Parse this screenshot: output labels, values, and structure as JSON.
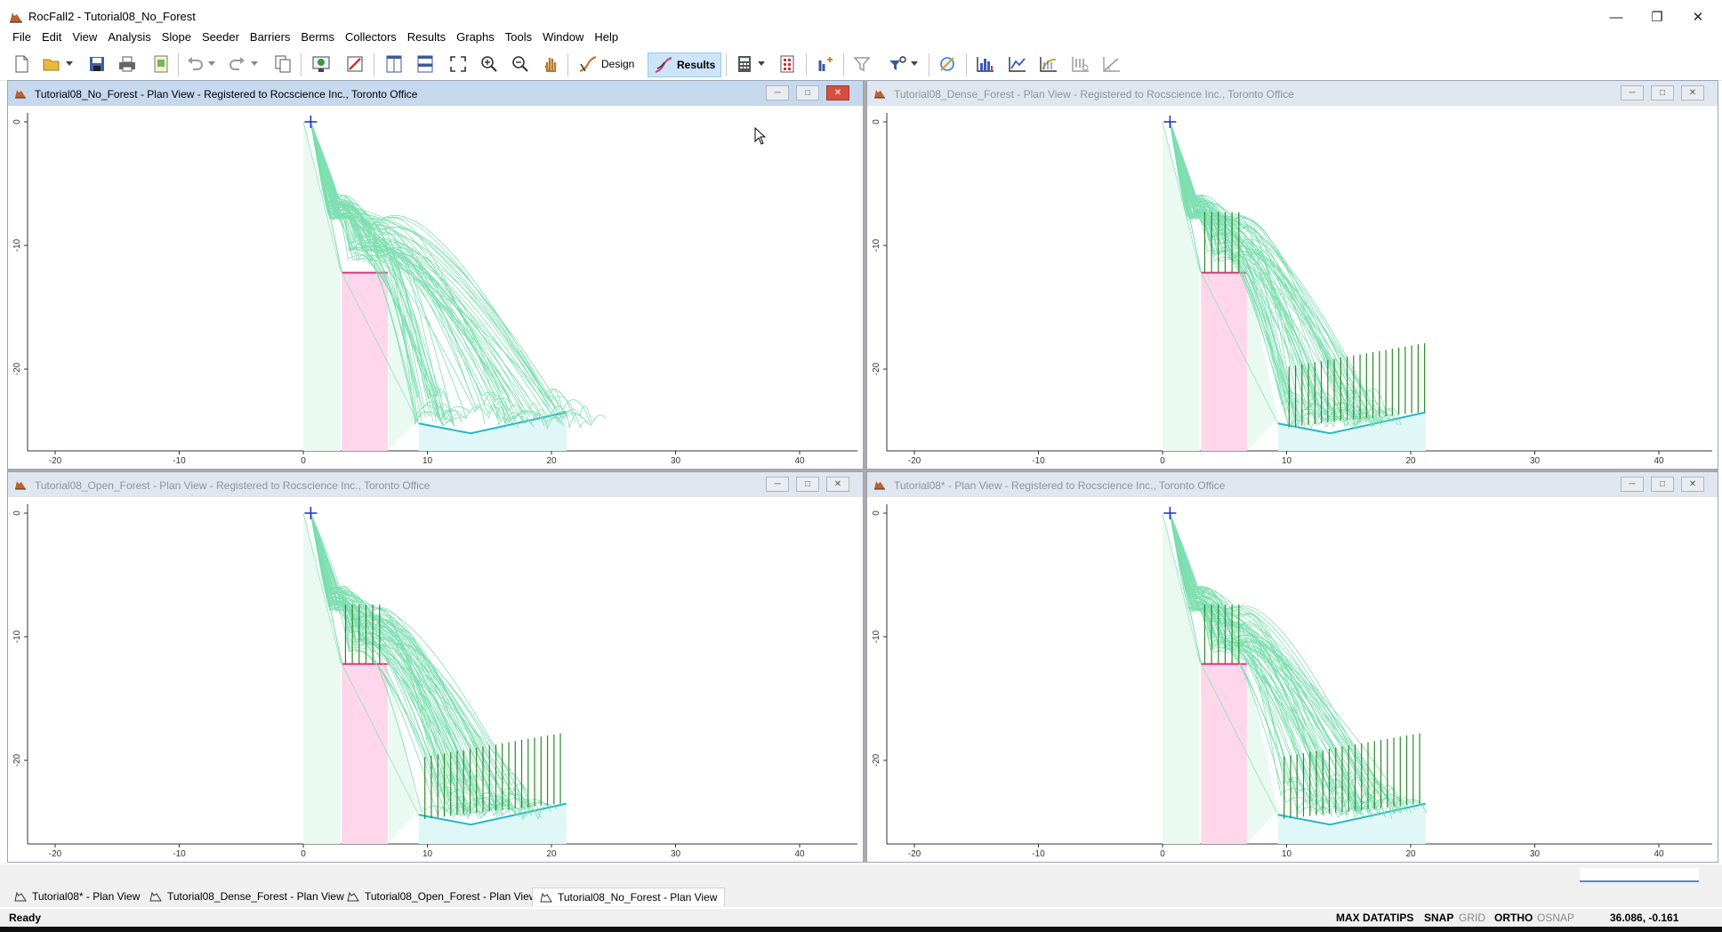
{
  "app": {
    "title": "RocFall2 - Tutorial08_No_Forest",
    "window_buttons": [
      "minimize",
      "restore",
      "close"
    ]
  },
  "menu": [
    "File",
    "Edit",
    "View",
    "Analysis",
    "Slope",
    "Seeder",
    "Barriers",
    "Berms",
    "Collectors",
    "Results",
    "Graphs",
    "Tools",
    "Window",
    "Help"
  ],
  "toolbar": {
    "design_label": "Design",
    "results_label": "Results"
  },
  "panes": [
    {
      "title": "Tutorial08_No_Forest - Plan View - Registered to Rocscience Inc., Toronto Office",
      "active": true,
      "trees": "none"
    },
    {
      "title": "Tutorial08_Dense_Forest - Plan View - Registered to Rocscience Inc., Toronto Office",
      "active": false,
      "trees": "dense"
    },
    {
      "title": "Tutorial08_Open_Forest - Plan View - Registered to Rocscience Inc., Toronto Office",
      "active": false,
      "trees": "open"
    },
    {
      "title": "Tutorial08* - Plan View - Registered to Rocscience Inc., Toronto Office",
      "active": false,
      "trees": "open"
    }
  ],
  "axes": {
    "x_ticks": [
      "-20",
      "-10",
      "0",
      "10",
      "20",
      "30",
      "40"
    ],
    "y_ticks": [
      "0",
      "-10",
      "-20"
    ]
  },
  "colors": {
    "trajectory": "#72dcaa",
    "barrier": "#ffd6ea",
    "barrier_top": "#e0307a",
    "slope_fill": "#eafaf1",
    "ground_line": "#26b7c8",
    "trees": "#2a8a2a",
    "seeder": "#1a2acc"
  },
  "tabs": [
    {
      "label": "Tutorial08* - Plan View",
      "active": false
    },
    {
      "label": "Tutorial08_Dense_Forest - Plan View",
      "active": false
    },
    {
      "label": "Tutorial08_Open_Forest - Plan View",
      "active": false
    },
    {
      "label": "Tutorial08_No_Forest - Plan View",
      "active": true
    }
  ],
  "status": {
    "ready": "Ready",
    "max_datatips": "MAX DATATIPS",
    "snap": "SNAP",
    "grid": "GRID",
    "ortho": "ORTHO",
    "osnap": "OSNAP",
    "coords": "36.086, -0.161"
  }
}
